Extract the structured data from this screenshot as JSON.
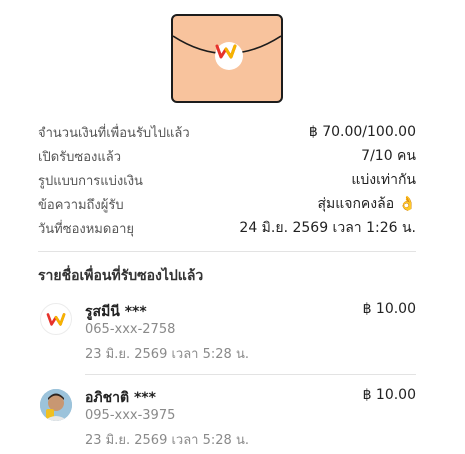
{
  "details": [
    {
      "label": "จำนวนเงินที่เพื่อนรับไปแล้ว",
      "value": "฿ 70.00/100.00"
    },
    {
      "label": "เปิดรับซองแล้ว",
      "value": "7/10 คน"
    },
    {
      "label": "รูปแบบการแบ่งเงิน",
      "value": "แบ่งเท่ากัน"
    },
    {
      "label": "ข้อความถึงผู้รับ",
      "value": "สุ่มแจกคงล้อ 👌"
    },
    {
      "label": "วันที่ซองหมดอายุ",
      "value": "24 มิ.ย. 2569 เวลา 1:26 น."
    }
  ],
  "friends_section_title": "รายชื่อเพื่อนที่รับซองไปแล้ว",
  "friends": [
    {
      "name": "รูสมีนี ***",
      "phone": "065-xxx-2758",
      "date": "23 มิ.ย. 2569 เวลา 5:28 น.",
      "amount": "฿ 10.00",
      "avatar": "brand-logo"
    },
    {
      "name": "อภิชาติ ***",
      "phone": "095-xxx-3975",
      "date": "23 มิ.ย. 2569 เวลา 5:28 น.",
      "amount": "฿ 10.00",
      "avatar": "user-photo"
    }
  ],
  "colors": {
    "envelope": "#f8c39d",
    "brand_red": "#e6322b",
    "brand_yellow": "#f5b400"
  }
}
